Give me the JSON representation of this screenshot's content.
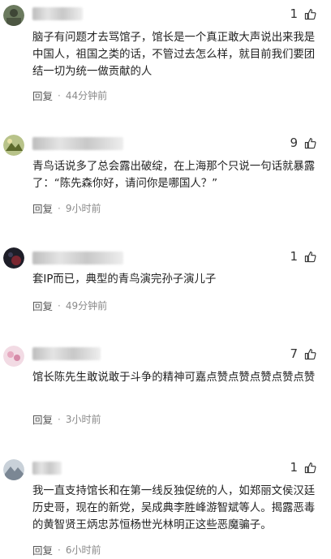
{
  "comments": [
    {
      "username": "···丽美·",
      "likes": "1",
      "text": "脑子有问题才去骂馆子，馆长是一个真正敢大声说出来我是中国人，祖国之类的话，不管过去怎么样，就目前我们要团结一切为统一做贡献的人",
      "reply": "回复",
      "time": "44分钟前",
      "avatar_color": "#6b7a5e"
    },
    {
      "username": "",
      "likes": "9",
      "text": "青鸟话说多了总会露出破绽，在上海那个只说一句话就暴露了：“陈先森你好，请问你是哪国人？”",
      "reply": "回复",
      "time": "9小时前",
      "avatar_color": "#8a9a4a"
    },
    {
      "username": "",
      "likes": "1",
      "text": "套IP而已，典型的青鸟演完孙子演儿子",
      "reply": "回复",
      "time": "49分钟前",
      "avatar_color": "#1e1e28"
    },
    {
      "username": "",
      "likes": "7",
      "text": "馆长陈先生敢说敢于斗争的精神可嘉点赞点赞点赞点赞点赞",
      "reply": "回复",
      "time": "3小时前",
      "avatar_color": "#e6c4d2"
    },
    {
      "username": "",
      "likes": "1",
      "text": "我一直支持馆长和在第一线反独促统的人，如郑丽文侯汉廷历史哥，现在的新党，吴成典李胜峰游智斌等人。揭露恶毒的黄智贤王炳忠苏恒杨世光林明正这些恶魔骗子。",
      "reply": "回复",
      "time": "6小时前",
      "avatar_color": "#9aa3ad"
    }
  ]
}
